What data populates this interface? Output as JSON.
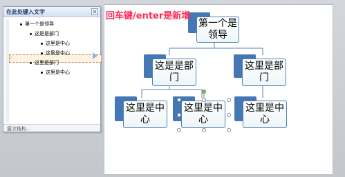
{
  "text_pane": {
    "title": "在此处键入文字",
    "close_glyph": "✕",
    "items": [
      {
        "text": "第一个是领导",
        "level": 1
      },
      {
        "text": "这是是部门",
        "level": 2
      },
      {
        "text": "这里是中心",
        "level": 3
      },
      {
        "text": "这里是中心",
        "level": 3
      },
      {
        "text": "这里是部门",
        "level": 2
      },
      {
        "text": "这里是中心",
        "level": 3
      }
    ],
    "footer": "层次结构..."
  },
  "annotation": "回车键/enter是新增",
  "smartart": {
    "top": "第一个是领导",
    "departments": [
      "这是是部门",
      "这里是部门"
    ],
    "centers": [
      "这里是中心",
      "这里是中心",
      "这里是中心"
    ]
  },
  "colors": {
    "accent": "#4477b3",
    "annotation": "#ff2a55",
    "selection": "#c88a2a"
  }
}
